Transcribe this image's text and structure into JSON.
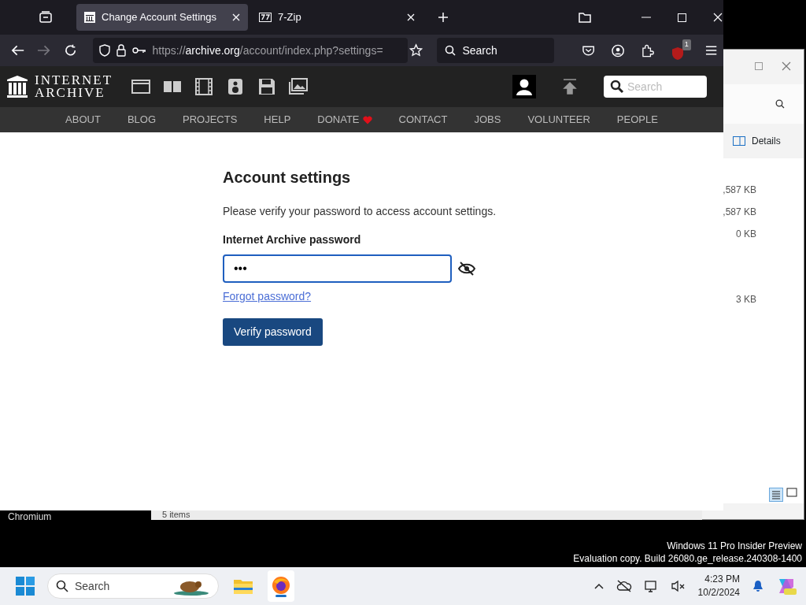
{
  "browser": {
    "tabs": [
      {
        "title": "Change Account Settings",
        "selected": true
      },
      {
        "title": "7-Zip",
        "selected": false
      }
    ],
    "url": {
      "scheme": "https://",
      "host": "archive.org",
      "path": "/account/index.php?settings="
    },
    "search_placeholder": "Search",
    "extension_badge": "1"
  },
  "site": {
    "logo_lines": [
      "INTERNET",
      "ARCHIVE"
    ],
    "search_placeholder": "Search",
    "nav": [
      {
        "label": "ABOUT"
      },
      {
        "label": "BLOG"
      },
      {
        "label": "PROJECTS"
      },
      {
        "label": "HELP"
      },
      {
        "label": "DONATE",
        "kind": "donate"
      },
      {
        "label": "CONTACT"
      },
      {
        "label": "JOBS"
      },
      {
        "label": "VOLUNTEER"
      },
      {
        "label": "PEOPLE"
      }
    ],
    "heading": "Account settings",
    "prompt": "Please verify your password to access account settings.",
    "field_label": "Internet Archive password",
    "password": "•••",
    "password_visible": false,
    "forgot_link": "Forgot password?",
    "verify_button": "Verify password"
  },
  "explorer": {
    "details": "Details",
    "sizes": [
      ",587 KB",
      ",587 KB",
      "0 KB",
      "3 KB"
    ],
    "status": "5 items"
  },
  "desktop": {
    "label": "Chromium",
    "watermark": [
      "Windows 11 Pro Insider Preview",
      "Evaluation copy. Build 26080.ge_release.240308-1400"
    ]
  },
  "taskbar": {
    "search_placeholder": "Search",
    "time": "4:23 PM",
    "date": "10/2/2024"
  }
}
